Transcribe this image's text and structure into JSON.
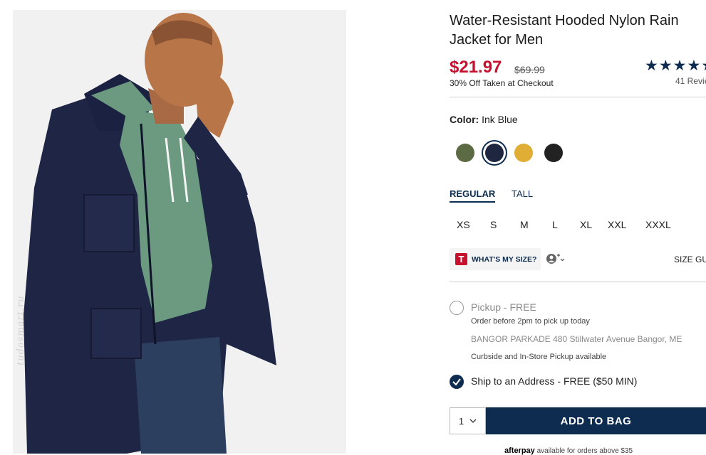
{
  "product": {
    "title": "Water-Resistant Hooded Nylon Rain Jacket for Men",
    "price": "$21.97",
    "original_price": "$69.99",
    "promo_text": "30% Off Taken at Checkout",
    "rating_stars": "★★★★★",
    "review_count": "41 Revie"
  },
  "image": {
    "watermark": "tudasmart.ru",
    "subject": "man-in-navy-rain-jacket-icon"
  },
  "color": {
    "label": "Color:",
    "selected": "Ink Blue",
    "swatches": [
      {
        "name": "olive",
        "hex": "#5d6b45"
      },
      {
        "name": "ink-blue",
        "hex": "#1f2640"
      },
      {
        "name": "mustard",
        "hex": "#e0ad35"
      },
      {
        "name": "black",
        "hex": "#222222"
      }
    ]
  },
  "fit": {
    "tabs": [
      "REGULAR",
      "TALL"
    ],
    "selected": "REGULAR"
  },
  "sizes": [
    "XS",
    "S",
    "M",
    "L",
    "XL",
    "XXL",
    "XXXL"
  ],
  "size_tools": {
    "whats_my_size_badge": "T",
    "whats_my_size": "WHAT'S MY SIZE?",
    "profile_icon": "person-plus-icon",
    "size_guide": "SIZE GU"
  },
  "fulfillment": {
    "pickup_label": "Pickup - FREE",
    "pickup_note": "Order before 2pm to pick up today",
    "store": "BANGOR PARKADE 480 Stillwater Avenue  Bangor, ME",
    "curbside": "Curbside and In-Store Pickup available",
    "ship_label": "Ship to an Address - FREE ($50 MIN)",
    "selected": "ship"
  },
  "cart": {
    "quantity": "1",
    "add_to_bag": "ADD TO BAG"
  },
  "afterpay": {
    "brand": "afterpay",
    "text": "available for orders above $35"
  },
  "colors": {
    "accent": "#0d2c4f",
    "sale": "#c8102e"
  }
}
